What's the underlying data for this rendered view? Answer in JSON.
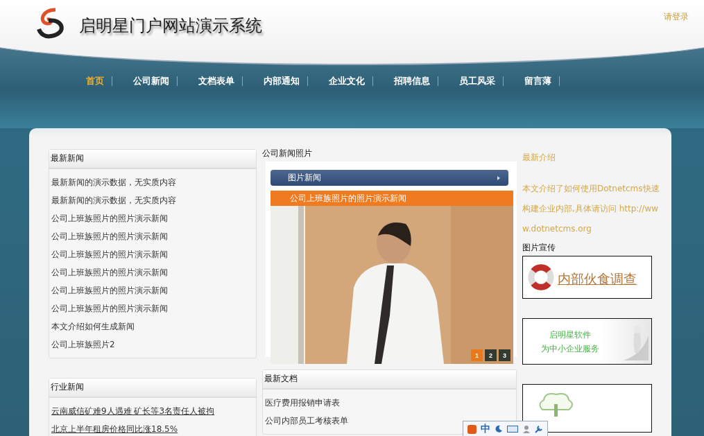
{
  "header": {
    "title": "启明星门户网站演示系统",
    "login_link": "请登录"
  },
  "nav": [
    {
      "label": "首页",
      "selected": true
    },
    {
      "label": "公司新闻",
      "selected": false
    },
    {
      "label": "文档表单",
      "selected": false
    },
    {
      "label": "内部通知",
      "selected": false
    },
    {
      "label": "企业文化",
      "selected": false
    },
    {
      "label": "招聘信息",
      "selected": false
    },
    {
      "label": "员工风采",
      "selected": false
    },
    {
      "label": "留言薄",
      "selected": false
    }
  ],
  "latest_news": {
    "title": "最新新闻",
    "items": [
      "最新新闻的演示数据，无实质内容",
      "最新新闻的演示数据，无实质内容",
      "公司上班族照片的照片演示新闻",
      "公司上班族照片的照片演示新闻",
      "公司上班族照片的照片演示新闻",
      "公司上班族照片的照片演示新闻",
      "公司上班族照片的照片演示新闻",
      "公司上班族照片的照片演示新闻",
      "本文介绍如何生成新闻",
      "公司上班族照片2"
    ]
  },
  "industry_news": {
    "title": "行业新闻",
    "items": [
      "云南威信矿难9人遇难 矿长等3名责任人被拘",
      "北京上半年租房价格同比涨18.5%"
    ]
  },
  "photo_news": {
    "title": "公司新闻照片",
    "tab": "图片新闻",
    "caption": "公司上班族照片的照片演示新闻",
    "pages": [
      {
        "label": "1",
        "selected": true
      },
      {
        "label": "2",
        "selected": false
      },
      {
        "label": "3",
        "selected": false
      }
    ]
  },
  "latest_docs": {
    "title": "最新文档",
    "items": [
      "医疗费用报销申请表",
      "公司内部员工考核表单"
    ]
  },
  "intro": {
    "title": "最新介绍",
    "text": "本文介绍了如何使用Dotnetcms快速构建企业内部,具体请访问 http://www.dotnetcms.org"
  },
  "promo": {
    "title": "图片宣传",
    "banners": [
      {
        "kind": "survey",
        "lines": [
          "内部伙食调查"
        ]
      },
      {
        "kind": "service",
        "lines": [
          "启明星软件",
          "为中小企业服务"
        ]
      },
      {
        "kind": "cloud"
      }
    ]
  },
  "ime_bar": {
    "label": "中"
  }
}
